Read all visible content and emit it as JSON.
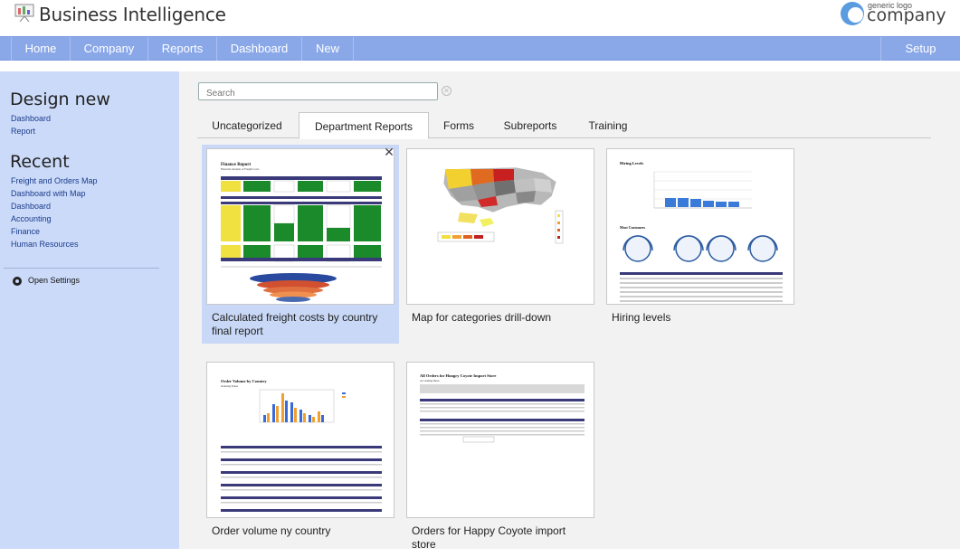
{
  "app": {
    "title": "Business Intelligence",
    "logo_small": "generic logo",
    "logo_big": "company"
  },
  "nav": {
    "items": [
      "Home",
      "Company",
      "Reports",
      "Dashboard",
      "New"
    ],
    "setup": "Setup"
  },
  "sidebar": {
    "design_heading": "Design new",
    "design_links": [
      "Dashboard",
      "Report"
    ],
    "recent_heading": "Recent",
    "recent_links": [
      "Freight and Orders Map",
      "Dashboard with Map",
      "Dashboard",
      "Accounting",
      "Finance",
      "Human Resources"
    ],
    "settings_label": "Open Settings"
  },
  "search": {
    "placeholder": "Search"
  },
  "tabs": [
    "Uncategorized",
    "Department Reports",
    "Forms",
    "Subreports",
    "Training"
  ],
  "active_tab": "Department Reports",
  "reports": [
    {
      "title": "Calculated freight costs by country final report",
      "selected": true,
      "preview_heading": "Finance Report",
      "preview_sub": "Financial Analysis of Freight Costs"
    },
    {
      "title": "Map for categories drill-down",
      "selected": false
    },
    {
      "title": "Hiring levels",
      "selected": false,
      "preview_heading": "Hiring Levels",
      "preview_sub": "Most Customers"
    },
    {
      "title": "Order volume ny country",
      "selected": false,
      "preview_heading": "Order Volume by Country",
      "preview_sub": "Ordering Status"
    },
    {
      "title": "Orders for Happy Coyote import store",
      "selected": false,
      "preview_heading": "All Orders for Hungry Coyote Import Store",
      "preview_sub": "Accounting Dates"
    }
  ],
  "colors": {
    "navbar": "#8aa8e8",
    "sidebar": "#cbdaf8",
    "selected_card": "#c8d8f6",
    "link": "#1a3c8c"
  }
}
